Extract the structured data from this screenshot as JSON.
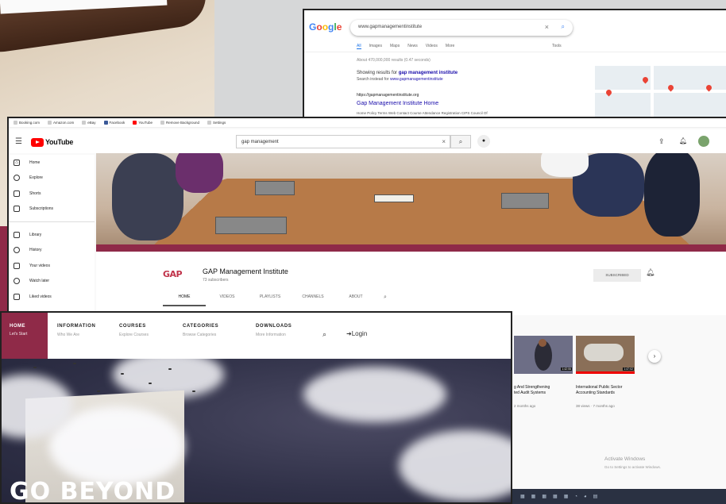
{
  "google": {
    "logo": "Google",
    "query": "www.gapmanagementinstitute",
    "tabs": [
      "All",
      "Images",
      "Maps",
      "News",
      "Videos",
      "More"
    ],
    "tools": "Tools",
    "about": "About 470,000,000 results (0.47 seconds)",
    "showing_prefix": "Showing results for",
    "showing_term": "gap management institute",
    "search_instead_prefix": "Search instead for",
    "search_instead_term": "www.gapmanagementinstitute",
    "result_url": "https://gapmanagementinstitute.org",
    "result_title": "Gap Management Institute Home",
    "result_snippet": "Home  Policy  Terms  Web  Contact  Course  Attendance  Registration  CIPS  Council Of"
  },
  "youtube": {
    "bookmarks": [
      "Booking.com",
      "Amazon.com",
      "eBay",
      "Facebook",
      "YouTube",
      "Remove Background",
      "Settings"
    ],
    "logo_text": "YouTube",
    "search_value": "gap management",
    "sidebar": [
      "Home",
      "Explore",
      "Shorts",
      "Subscriptions",
      "Library",
      "History",
      "Your videos",
      "Watch later",
      "Liked videos"
    ],
    "channel_name": "GAP Management Institute",
    "channel_logo": "GAP",
    "subscribers": "73 subscribers",
    "subscribe_label": "SUBSCRIBED",
    "channel_tabs": [
      "HOME",
      "VIDEOS",
      "PLAYLISTS",
      "CHANNELS",
      "ABOUT"
    ],
    "videos": [
      {
        "title_1": "g And Strengthening",
        "title_2": "ted Audit Systems",
        "meta": "2 months ago",
        "duration": "1:42:06"
      },
      {
        "title_1": "International Public Sector",
        "title_2": "Accounting Standards",
        "meta": "38 views · 7 months ago",
        "duration": "1:47:02"
      }
    ],
    "activate_title": "Activate Windows",
    "activate_sub": "Go to Settings to activate Windows."
  },
  "gap_site": {
    "nav": [
      {
        "title": "HOME",
        "sub": "Let's Start"
      },
      {
        "title": "INFORMATION",
        "sub": "Who We Are"
      },
      {
        "title": "COURSES",
        "sub": "Explore Courses"
      },
      {
        "title": "CATEGORIES",
        "sub": "Browse Categories"
      },
      {
        "title": "DOWNLOADS",
        "sub": "More Information"
      }
    ],
    "login": "Login",
    "hero_text": "GO BEYOND"
  },
  "colors": {
    "brand_maroon": "#8f2a48",
    "youtube_red": "#ff0000",
    "google_blue": "#4285f4"
  }
}
